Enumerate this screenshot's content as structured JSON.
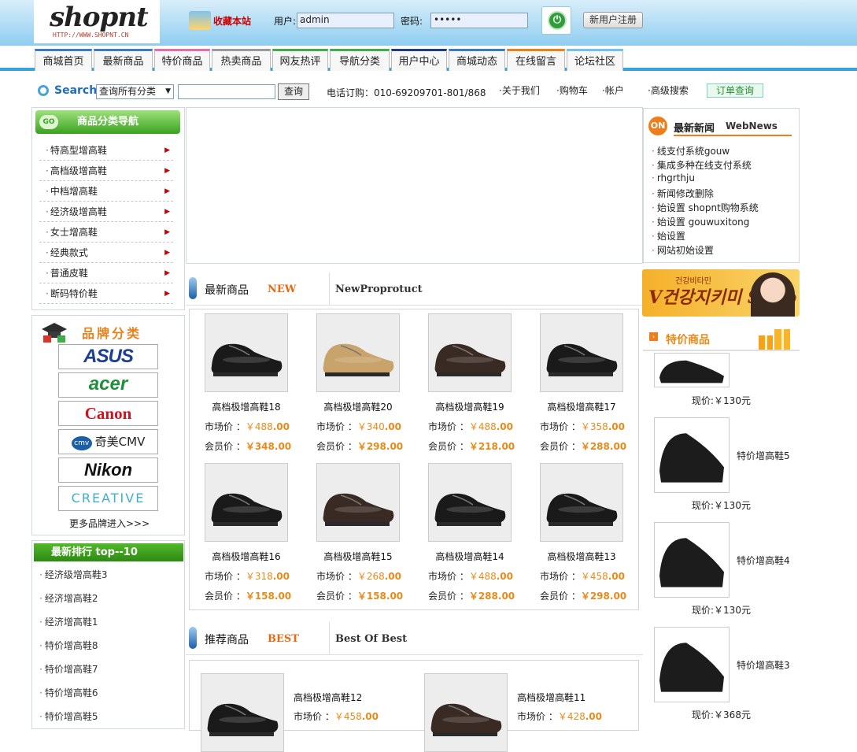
{
  "header": {
    "logo_text": "shopnt",
    "logo_url": "HTTP://WWW.SHOPNT.CN",
    "favorite_label": "收藏本站",
    "user_label": "用户:",
    "user_value": "admin",
    "password_label": "密码:",
    "password_value": "•••••",
    "register_label": "新用户注册",
    "login_glyph": "⏻"
  },
  "nav": [
    "商城首页",
    "最新商品",
    "特价商品",
    "热卖商品",
    "网友热评",
    "导航分类",
    "用户中心",
    "商城动态",
    "在线留言",
    "论坛社区"
  ],
  "search": {
    "label": "Search",
    "category_selected": "查询所有分类",
    "button": "查询",
    "phone": "电话订购：010-69209701-801/868",
    "links": [
      "·关于我们",
      "·购物车",
      "·帐户",
      "·高级搜索"
    ],
    "order_query": "订单查询"
  },
  "category_nav": {
    "title": "商品分类导航",
    "badge": "GO",
    "items": [
      "特高型增高鞋",
      "高档级增高鞋",
      "中档增高鞋",
      "经济级增高鞋",
      "女士增高鞋",
      "经典款式",
      "普通皮鞋",
      "断码特价鞋"
    ],
    "arrow": "▶"
  },
  "brands": {
    "title": "品牌分类",
    "items": [
      "ASUS",
      "acer",
      "Canon",
      "奇美CMV",
      "Nikon",
      "CREATIVE"
    ],
    "cmv_badge": "cmv",
    "more": "更多品牌进入>>>"
  },
  "top10": {
    "title": "最新排行  top--10",
    "items": [
      "经济级增高鞋3",
      "经济增高鞋2",
      "经济增高鞋1",
      "特价增高鞋8",
      "特价增高鞋7",
      "特价增高鞋6",
      "特价增高鞋5"
    ]
  },
  "new_section": {
    "title": "最新商品",
    "tag": "NEW",
    "en": "NewProprotuct",
    "products": [
      {
        "name": "高档极增高鞋18",
        "market": "￥488",
        "market_dec": ".00",
        "member": "￥348",
        "member_dec": ".00"
      },
      {
        "name": "高档极增高鞋20",
        "market": "￥340",
        "market_dec": ".00",
        "member": "￥298",
        "member_dec": ".00"
      },
      {
        "name": "高档极增高鞋19",
        "market": "￥488",
        "market_dec": ".00",
        "member": "￥218",
        "member_dec": ".00"
      },
      {
        "name": "高档极增高鞋17",
        "market": "￥358",
        "market_dec": ".00",
        "member": "￥288",
        "member_dec": ".00"
      },
      {
        "name": "高档极增高鞋16",
        "market": "￥318",
        "market_dec": ".00",
        "member": "￥158",
        "member_dec": ".00"
      },
      {
        "name": "高档极增高鞋15",
        "market": "￥268",
        "market_dec": ".00",
        "member": "￥158",
        "member_dec": ".00"
      },
      {
        "name": "高档极增高鞋14",
        "market": "￥488",
        "market_dec": ".00",
        "member": "￥288",
        "member_dec": ".00"
      },
      {
        "name": "高档极增高鞋13",
        "market": "￥458",
        "market_dec": ".00",
        "member": "￥298",
        "member_dec": ".00"
      }
    ],
    "market_label": "市场价 ：",
    "member_label": "会员价 ："
  },
  "best_section": {
    "title": "推荐商品",
    "tag": "BEST",
    "en": "Best  Of  Best",
    "products": [
      {
        "name": "高档极增高鞋12",
        "market": "￥458",
        "market_dec": ".00"
      },
      {
        "name": "高档极增高鞋11",
        "market": "￥428",
        "market_dec": ".00"
      }
    ],
    "market_label": "市场价 ："
  },
  "news": {
    "badge": "ON",
    "title": "最新新闻",
    "subtitle": "WebNews",
    "items": [
      "线支付系统gouw",
      "集成多种在线支付系统",
      "rhgrthju",
      "新闻修改删除",
      "始设置 shopnt购物系统",
      "始设置 gouwuxitong",
      "始设置",
      "网站初始设置"
    ]
  },
  "ad": {
    "small": "건강비타민",
    "text": "V건강지키미 Shop"
  },
  "specials": {
    "title": "特价商品",
    "items": [
      {
        "name": "",
        "price": "现价:￥130元"
      },
      {
        "name": "特价增高鞋5",
        "price": "现价:￥130元"
      },
      {
        "name": "特价增高鞋4",
        "price": "现价:￥130元"
      },
      {
        "name": "特价增高鞋3",
        "price": "现价:￥368元"
      }
    ]
  },
  "colors": {
    "accent": "#36a3dd",
    "price": "#e88a1a",
    "green": "#3aa21f"
  }
}
